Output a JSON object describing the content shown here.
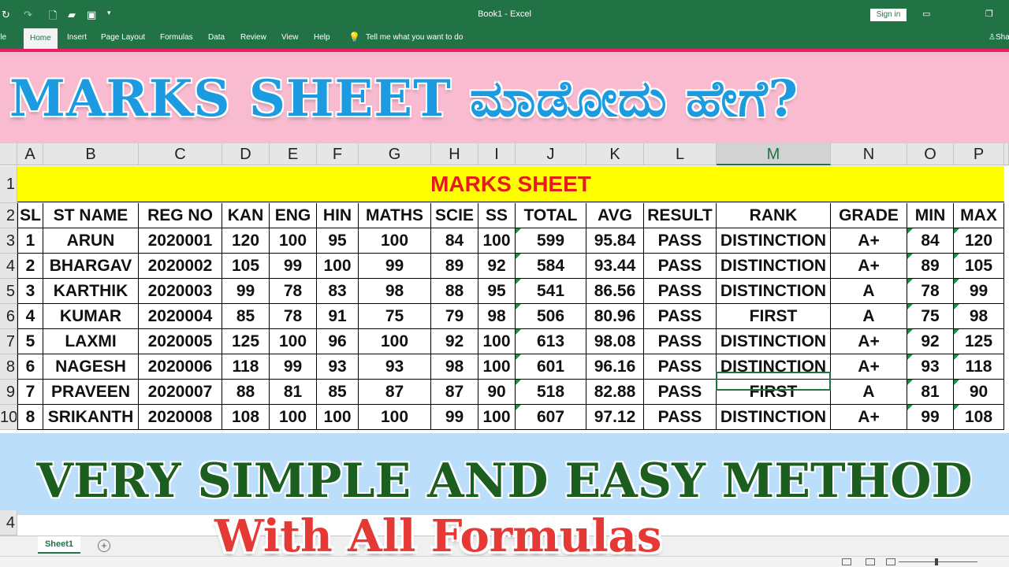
{
  "window": {
    "doc_title": "Book1  -  Excel",
    "sign_in": "Sign in"
  },
  "ribbon": {
    "file": "File",
    "tabs": [
      "Home",
      "Insert",
      "Page Layout",
      "Formulas",
      "Data",
      "Review",
      "View",
      "Help"
    ],
    "tell_me": "Tell me what you want to do",
    "share": "Share"
  },
  "banner_top": "MARKS SHEET ಮಾಡೋದು ಹೇಗೆ?",
  "columns": [
    "A",
    "B",
    "C",
    "D",
    "E",
    "F",
    "G",
    "H",
    "I",
    "J",
    "K",
    "L",
    "M",
    "N",
    "O",
    "P"
  ],
  "selected_column": "M",
  "row_numbers": [
    "1",
    "2",
    "3",
    "4",
    "5",
    "6",
    "7",
    "8",
    "9",
    "10"
  ],
  "sheet_title": "MARKS SHEET",
  "table": {
    "headers": [
      "SL",
      "ST NAME",
      "REG NO",
      "KAN",
      "ENG",
      "HIN",
      "MATHS",
      "SCIE",
      "SS",
      "TOTAL",
      "AVG",
      "RESULT",
      "RANK",
      "GRADE",
      "MIN",
      "MAX"
    ],
    "rows": [
      [
        "1",
        "ARUN",
        "2020001",
        "120",
        "100",
        "95",
        "100",
        "84",
        "100",
        "599",
        "95.84",
        "PASS",
        "DISTINCTION",
        "A+",
        "84",
        "120"
      ],
      [
        "2",
        "BHARGAV",
        "2020002",
        "105",
        "99",
        "100",
        "99",
        "89",
        "92",
        "584",
        "93.44",
        "PASS",
        "DISTINCTION",
        "A+",
        "89",
        "105"
      ],
      [
        "3",
        "KARTHIK",
        "2020003",
        "99",
        "78",
        "83",
        "98",
        "88",
        "95",
        "541",
        "86.56",
        "PASS",
        "DISTINCTION",
        "A",
        "78",
        "99"
      ],
      [
        "4",
        "KUMAR",
        "2020004",
        "85",
        "78",
        "91",
        "75",
        "79",
        "98",
        "506",
        "80.96",
        "PASS",
        "FIRST",
        "A",
        "75",
        "98"
      ],
      [
        "5",
        "LAXMI",
        "2020005",
        "125",
        "100",
        "96",
        "100",
        "92",
        "100",
        "613",
        "98.08",
        "PASS",
        "DISTINCTION",
        "A+",
        "92",
        "125"
      ],
      [
        "6",
        "NAGESH",
        "2020006",
        "118",
        "99",
        "93",
        "93",
        "98",
        "100",
        "601",
        "96.16",
        "PASS",
        "DISTINCTION",
        "A+",
        "93",
        "118"
      ],
      [
        "7",
        "PRAVEEN",
        "2020007",
        "88",
        "81",
        "85",
        "87",
        "87",
        "90",
        "518",
        "82.88",
        "PASS",
        "FIRST",
        "A",
        "81",
        "90"
      ],
      [
        "8",
        "SRIKANTH",
        "2020008",
        "108",
        "100",
        "100",
        "100",
        "99",
        "100",
        "607",
        "97.12",
        "PASS",
        "DISTINCTION",
        "A+",
        "99",
        "108"
      ]
    ]
  },
  "banner_bottom": "VERY SIMPLE AND EASY METHOD",
  "banner_formulas": "With All Formulas",
  "partial_row_number": "4",
  "sheet_tab": "Sheet1",
  "add_sheet_symbol": "+",
  "colors": {
    "excel_green": "#217346",
    "title_yellow": "#ffff00",
    "title_red": "#e31c1c",
    "banner_pink": "#f8bbd0",
    "banner_blue_text": "#1c9be0",
    "banner_light_blue": "#bbdefb",
    "banner_green_text": "#1b5e20",
    "formulas_red": "#e53935"
  }
}
